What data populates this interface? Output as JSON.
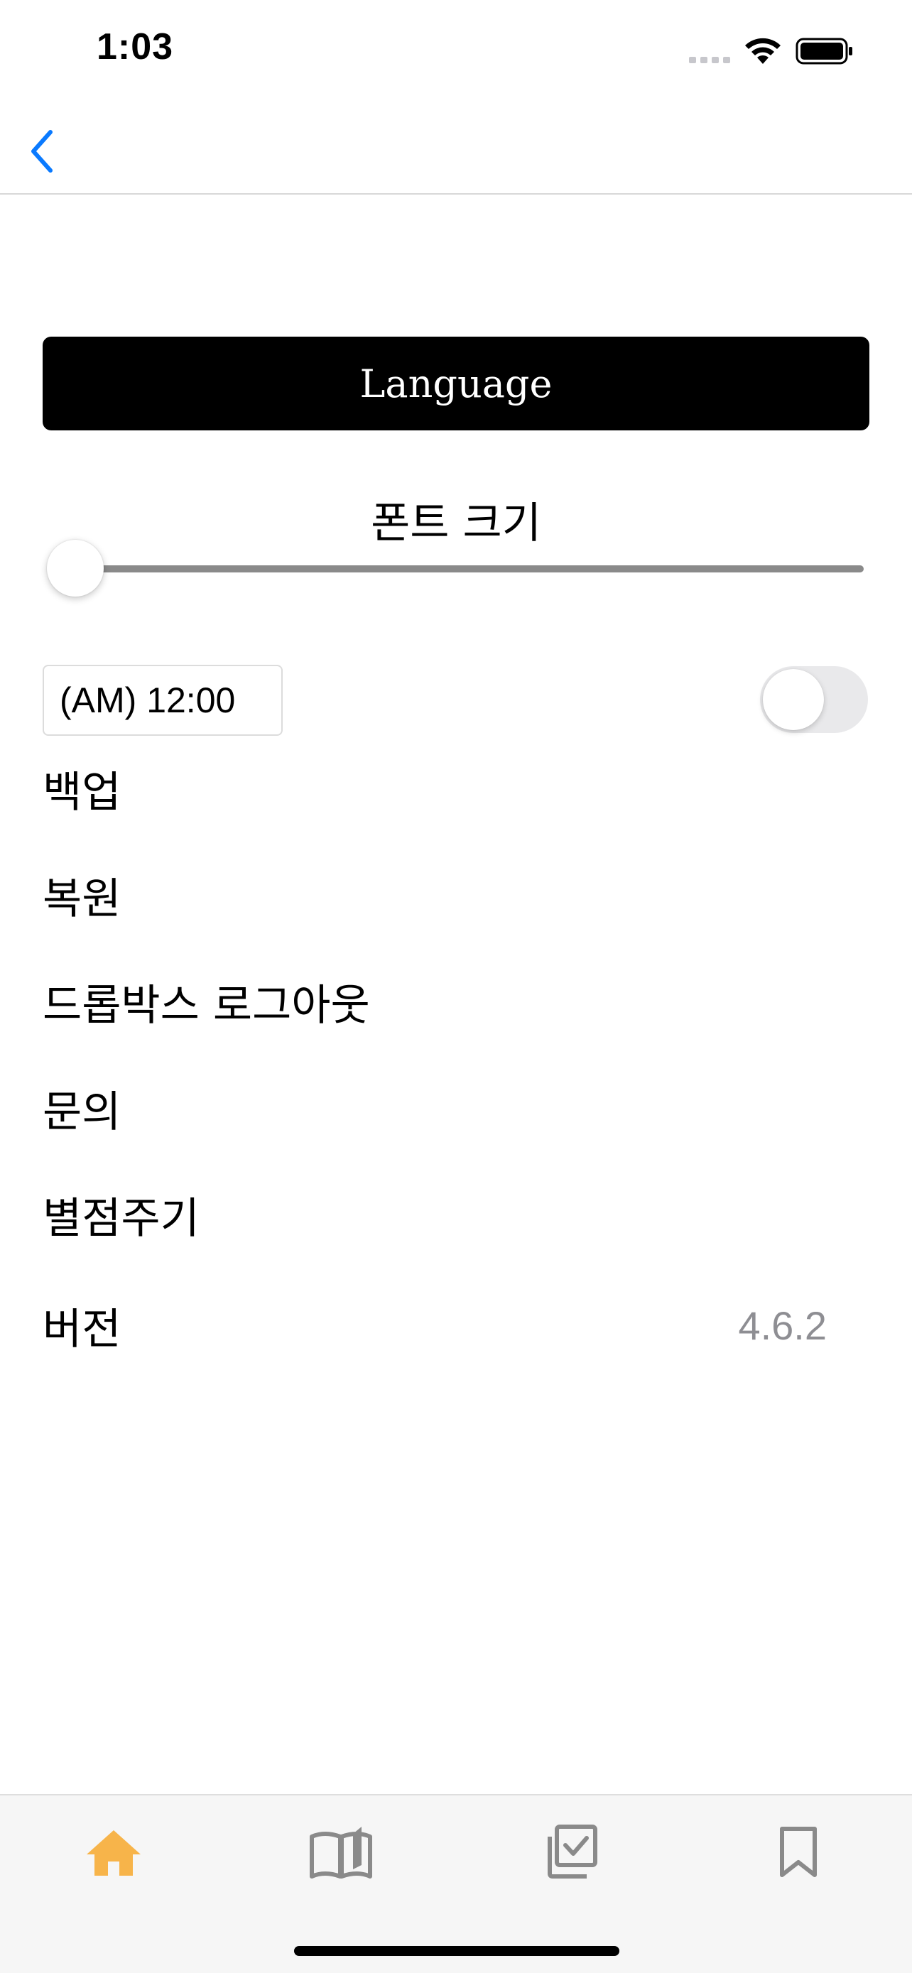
{
  "status_bar": {
    "time": "1:03",
    "icons": [
      "signal-icon",
      "wifi-icon",
      "battery-icon"
    ]
  },
  "nav": {
    "back_icon": "chevron-left-icon",
    "accent_color": "#0a7aff"
  },
  "settings": {
    "language_label": "Language",
    "font_size_label": "폰트 크기",
    "font_size_slider_value": 0,
    "notification_time": "(AM) 12:00",
    "notification_toggle_on": false,
    "menu": [
      {
        "label": "백업"
      },
      {
        "label": "복원"
      },
      {
        "label": "드롭박스 로그아웃"
      },
      {
        "label": "문의"
      },
      {
        "label": "별점주기"
      },
      {
        "label": "버전",
        "value": "4.6.2"
      }
    ]
  },
  "tab_bar": {
    "tabs": [
      {
        "icon": "home-icon",
        "active": true
      },
      {
        "icon": "book-icon",
        "active": false
      },
      {
        "icon": "checklist-icon",
        "active": false
      },
      {
        "icon": "bookmark-icon",
        "active": false
      }
    ],
    "active_color": "#f7b44a",
    "inactive_color": "#8a8a8a"
  }
}
